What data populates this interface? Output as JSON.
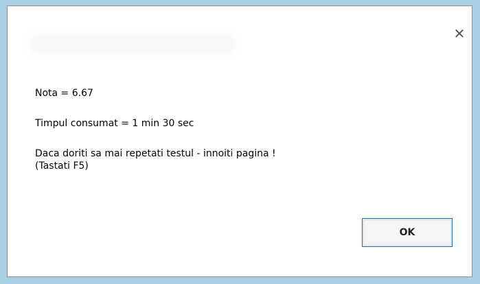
{
  "dialog": {
    "title": "",
    "close_glyph": "✕",
    "close_icon": "close-icon",
    "lines": [
      "Nota = 6.67",
      "Timpul consumat = 1 min 30 sec",
      "Daca doriti sa mai repetati testul - innoiti pagina !",
      "(Tastati F5)"
    ],
    "ok_label": "OK"
  },
  "colors": {
    "background": "#a9d1e3",
    "dialog_bg": "#ffffff",
    "button_border": "#1a6ab2"
  }
}
